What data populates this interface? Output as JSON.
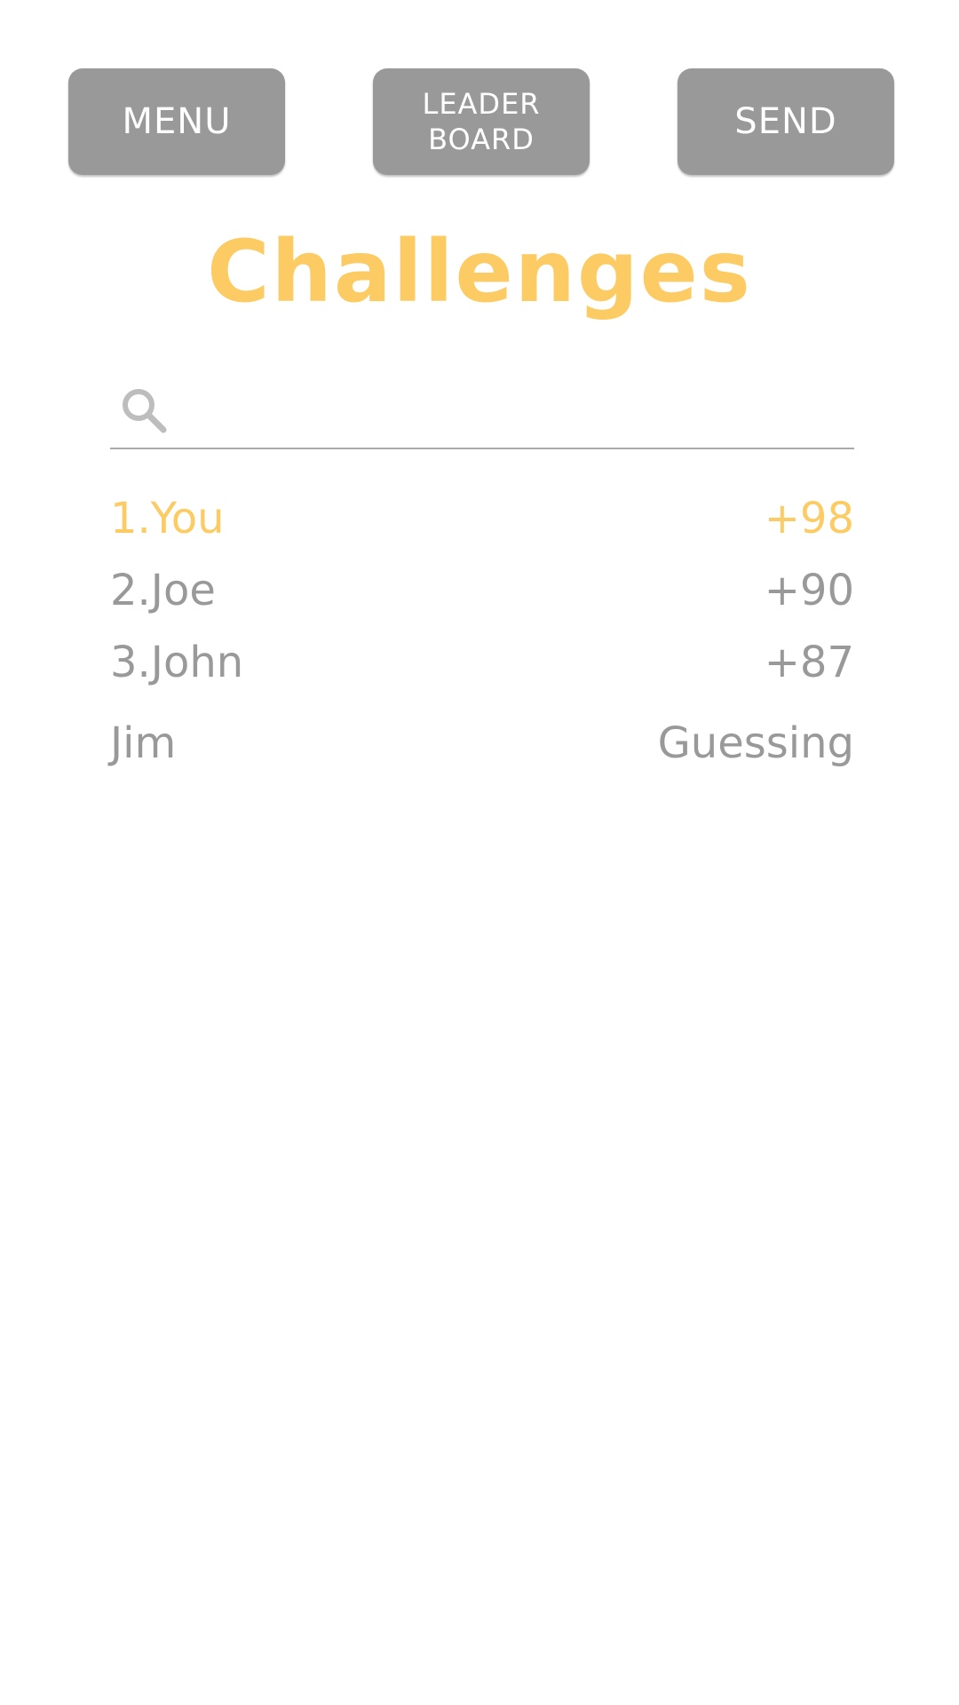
{
  "header": {
    "menu_label": "MENU",
    "leaderboard_line1": "LEADER",
    "leaderboard_line2": "BOARD",
    "send_label": "SEND"
  },
  "title": "Challenges",
  "search": {
    "placeholder": "",
    "value": "",
    "icon": "search-icon"
  },
  "list": {
    "items": [
      {
        "name": "1.You",
        "value": "+98",
        "highlight": true
      },
      {
        "name": "2.Joe",
        "value": "+90",
        "highlight": false
      },
      {
        "name": "3.John",
        "value": "+87",
        "highlight": false
      },
      {
        "name": "Jim",
        "value": "Guessing",
        "highlight": false
      }
    ]
  },
  "colors": {
    "accent": "#fccb64",
    "button": "#999999",
    "text_muted": "#999999",
    "background": "#ffffff"
  }
}
